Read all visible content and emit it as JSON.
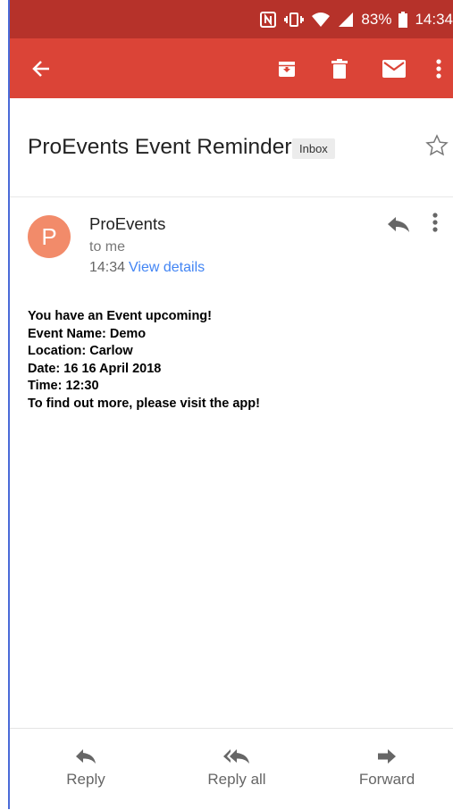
{
  "status_bar": {
    "battery": "83%",
    "time": "14:34",
    "icons": [
      "nfc-icon",
      "vibrate-icon",
      "wifi-icon",
      "signal-icon",
      "battery-icon"
    ]
  },
  "app_bar": {
    "color": "#db4437",
    "icons": [
      "back-arrow-icon",
      "archive-icon",
      "delete-icon",
      "mark-unread-icon",
      "more-vert-icon"
    ]
  },
  "email": {
    "subject": "ProEvents Event Reminder",
    "label": "Inbox",
    "sender": {
      "avatar_letter": "P",
      "avatar_color": "#f28b6a",
      "name": "ProEvents",
      "recipient": "to me",
      "time": "14:34",
      "details_link": "View details"
    },
    "body_lines": [
      "You have an Event upcoming!",
      "Event Name: Demo",
      "Location: Carlow",
      "Date: 16 16 April 2018",
      "Time: 12:30",
      "To find out more, please visit the app!"
    ]
  },
  "actions": [
    {
      "label": "Reply",
      "icon": "reply-icon"
    },
    {
      "label": "Reply all",
      "icon": "reply-all-icon"
    },
    {
      "label": "Forward",
      "icon": "forward-icon"
    }
  ]
}
